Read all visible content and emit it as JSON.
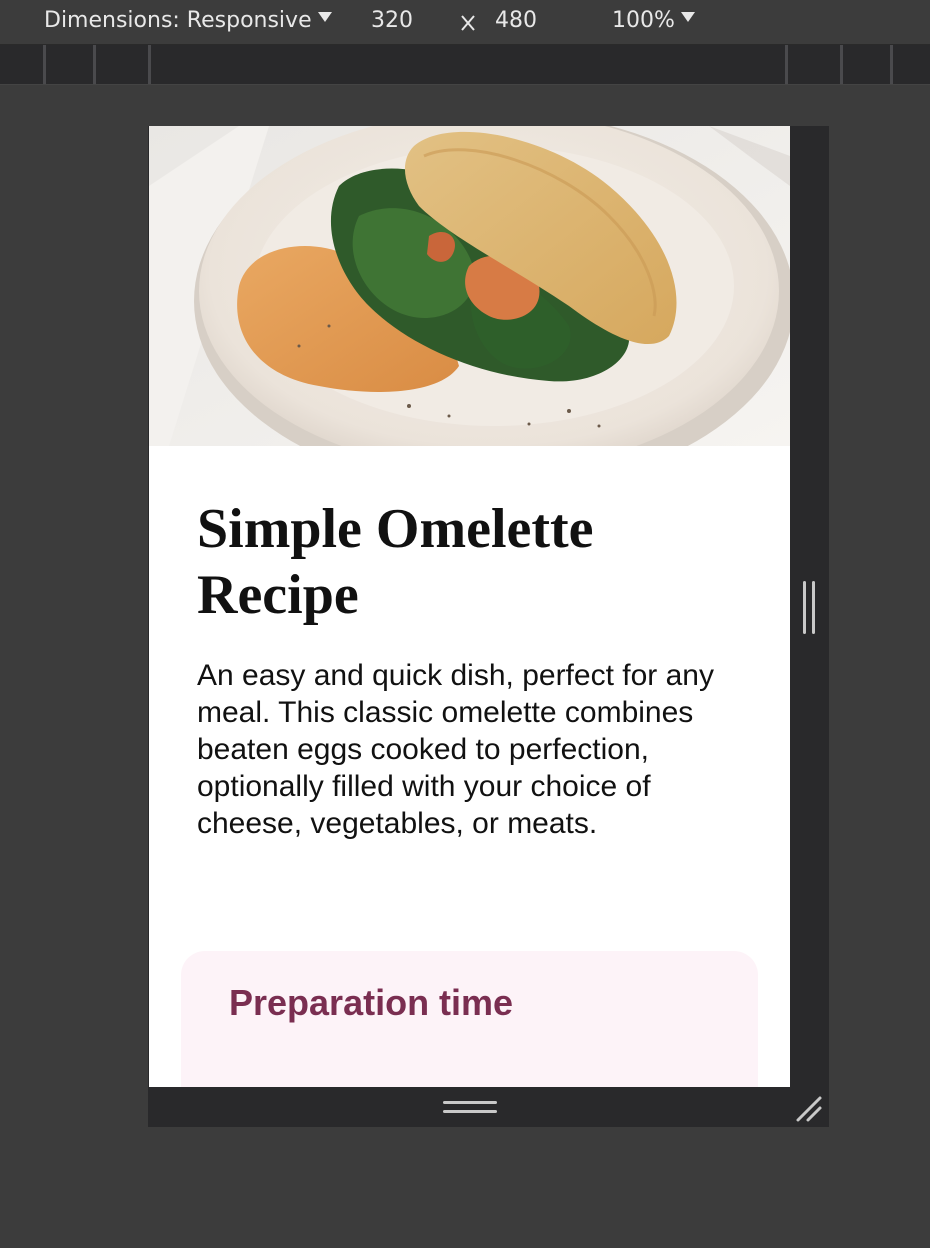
{
  "devtools": {
    "dimensions_label": "Dimensions: Responsive",
    "width_value": "320",
    "height_value": "480",
    "zoom_label": "100%",
    "icons": {
      "dimensions_dropdown": "caret-down-icon",
      "zoom_dropdown": "caret-down-icon",
      "separator": "close-icon",
      "right_resize": "resize-handle-icon",
      "bottom_resize": "resize-handle-icon",
      "corner_resize": "resize-corner-icon"
    }
  },
  "recipe": {
    "hero_image_alt": "omelette-photo",
    "title": "Simple Omelette Recipe",
    "description": "An easy and quick dish, perfect for any meal. This classic omelette combines beaten eggs cooked to perfection, optionally filled with your choice of cheese, vegetables, or meats.",
    "preparation": {
      "heading": "Preparation time"
    }
  },
  "colors": {
    "devtools_bg": "#3c3c3c",
    "devtools_dark": "#29292b",
    "prep_card_bg": "#fdf3f8",
    "prep_heading": "#7a2e51"
  }
}
